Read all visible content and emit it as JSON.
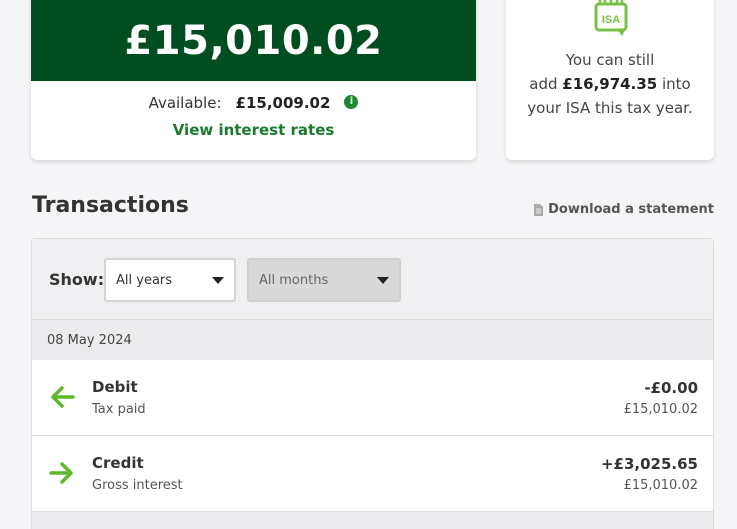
{
  "balance": {
    "amount": "£15,010.02",
    "available_label": "Available:",
    "available_value": "£15,009.02",
    "info_icon": "info-icon",
    "view_rates_label": "View interest rates"
  },
  "isa": {
    "icon": "isa-icon",
    "icon_label": "ISA",
    "line1": "You can still",
    "line2_prefix": "add ",
    "amount": "£16,974.35",
    "line2_suffix": " into",
    "line3": "your ISA this tax year."
  },
  "transactions": {
    "heading": "Transactions",
    "download_label": "Download a statement",
    "filters": {
      "show_label": "Show:",
      "year_value": "All years",
      "month_value": "All months"
    },
    "groups": [
      {
        "date": "08 May 2024",
        "items": [
          {
            "icon": "arrow-left-icon",
            "title": "Debit",
            "subtitle": "Tax paid",
            "amount": "-£0.00",
            "balance": "£15,010.02"
          },
          {
            "icon": "arrow-right-icon",
            "title": "Credit",
            "subtitle": "Gross interest",
            "amount": "+£3,025.65",
            "balance": "£15,010.02"
          }
        ]
      }
    ]
  },
  "colors": {
    "brand_dark_green": "#004d1f",
    "accent_green": "#1a7a2e",
    "arrow_green": "#5cb82b"
  }
}
